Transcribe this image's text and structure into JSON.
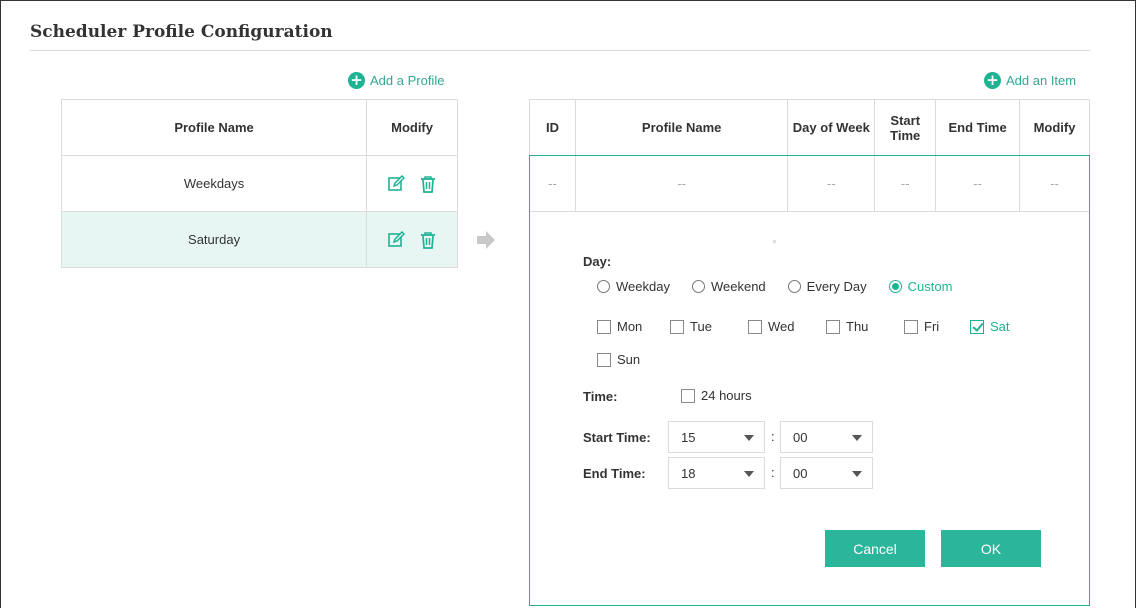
{
  "page": {
    "title": "Scheduler Profile Configuration"
  },
  "profiles": {
    "add_label": "Add a Profile",
    "headers": {
      "name": "Profile Name",
      "modify": "Modify"
    },
    "rows": [
      {
        "name": "Weekdays",
        "selected": false
      },
      {
        "name": "Saturday",
        "selected": true
      }
    ]
  },
  "items": {
    "add_label": "Add an Item",
    "headers": {
      "id": "ID",
      "profile_name": "Profile Name",
      "day_of_week": "Day of Week",
      "start_time": "Start Time",
      "end_time": "End Time",
      "modify": "Modify"
    },
    "empty_row": [
      "--",
      "--",
      "--",
      "--",
      "--",
      "--"
    ]
  },
  "form": {
    "day_label": "Day:",
    "day_options": [
      {
        "label": "Weekday",
        "selected": false
      },
      {
        "label": "Weekend",
        "selected": false
      },
      {
        "label": "Every Day",
        "selected": false
      },
      {
        "label": "Custom",
        "selected": true
      }
    ],
    "days": [
      {
        "label": "Mon",
        "checked": false
      },
      {
        "label": "Tue",
        "checked": false
      },
      {
        "label": "Wed",
        "checked": false
      },
      {
        "label": "Thu",
        "checked": false
      },
      {
        "label": "Fri",
        "checked": false
      },
      {
        "label": "Sat",
        "checked": true
      },
      {
        "label": "Sun",
        "checked": false
      }
    ],
    "time_label": "Time:",
    "hours24_label": "24 hours",
    "hours24_checked": false,
    "start_time_label": "Start Time:",
    "start_hour": "15",
    "start_minute": "00",
    "end_time_label": "End Time:",
    "end_hour": "18",
    "end_minute": "00",
    "colon": ":",
    "cancel_label": "Cancel",
    "ok_label": "OK"
  },
  "colors": {
    "accent": "#1fb394",
    "selected_row": "#e8f6f3",
    "border": "#dcdcdc"
  },
  "icons": {
    "add": "plus-circle-icon",
    "edit": "edit-icon",
    "delete": "trash-icon",
    "arrow": "arrow-right-icon"
  }
}
